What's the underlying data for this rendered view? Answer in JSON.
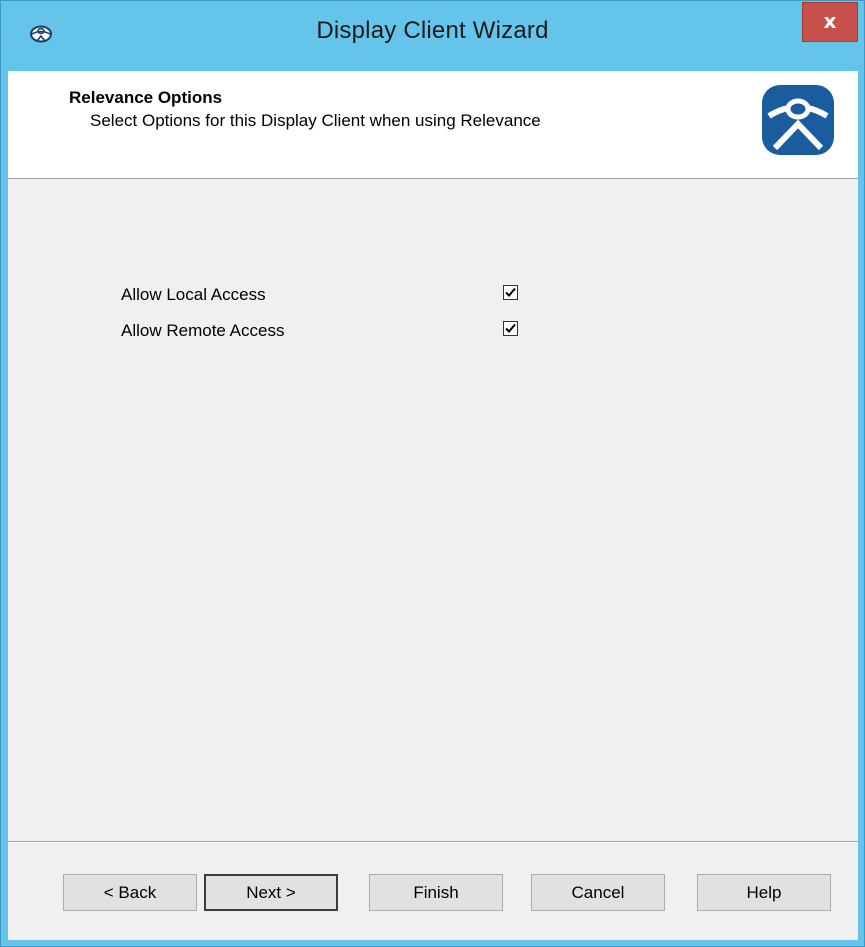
{
  "window": {
    "title": "Display Client Wizard",
    "close_glyph": "x"
  },
  "header": {
    "title": "Relevance Options",
    "subtitle": "Select Options for this Display Client when using Relevance",
    "logo_icon": "thinmanager-logo-icon"
  },
  "options": [
    {
      "label": "Allow Local Access",
      "checked": true
    },
    {
      "label": "Allow Remote Access",
      "checked": true
    }
  ],
  "buttons": {
    "back": "< Back",
    "next": "Next >",
    "finish": "Finish",
    "cancel": "Cancel",
    "help": "Help"
  },
  "colors": {
    "title_bar": "#65c4e9",
    "close_button": "#c7504a",
    "logo_blue": "#1a5c9e"
  }
}
